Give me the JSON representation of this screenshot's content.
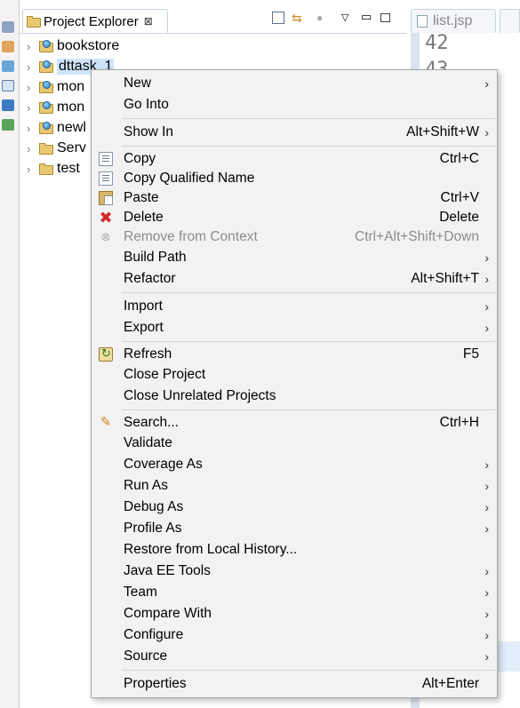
{
  "explorer": {
    "title": "Project Explorer",
    "close_glyph": "⊠",
    "tree": [
      {
        "name": "bookstore",
        "selected": false
      },
      {
        "name": "dttask_1",
        "selected": true
      },
      {
        "name": "mon",
        "selected": false
      },
      {
        "name": "mon",
        "selected": false
      },
      {
        "name": "newl",
        "selected": false
      },
      {
        "name": "Serv",
        "selected": false
      },
      {
        "name": "test",
        "selected": false
      }
    ]
  },
  "editor": {
    "tab_label": "list.jsp",
    "line_numbers": [
      "42",
      "43"
    ]
  },
  "menu": {
    "items": [
      {
        "label": "New",
        "shortcut": "",
        "submenu": true,
        "icon": ""
      },
      {
        "label": "Go Into",
        "shortcut": "",
        "submenu": false,
        "icon": ""
      },
      {
        "label": "Show In",
        "shortcut": "Alt+Shift+W",
        "submenu": true,
        "icon": ""
      },
      {
        "label": "Copy",
        "shortcut": "Ctrl+C",
        "submenu": false,
        "icon": "copy-icon"
      },
      {
        "label": "Copy Qualified Name",
        "shortcut": "",
        "submenu": false,
        "icon": "copy-qualified-name-icon"
      },
      {
        "label": "Paste",
        "shortcut": "Ctrl+V",
        "submenu": false,
        "icon": "paste-icon"
      },
      {
        "label": "Delete",
        "shortcut": "Delete",
        "submenu": false,
        "icon": "delete-icon"
      },
      {
        "label": "Remove from Context",
        "shortcut": "Ctrl+Alt+Shift+Down",
        "submenu": false,
        "icon": "remove-from-context-icon",
        "disabled": true
      },
      {
        "label": "Build Path",
        "shortcut": "",
        "submenu": true,
        "icon": ""
      },
      {
        "label": "Refactor",
        "shortcut": "Alt+Shift+T",
        "submenu": true,
        "icon": ""
      },
      {
        "label": "Import",
        "shortcut": "",
        "submenu": true,
        "icon": ""
      },
      {
        "label": "Export",
        "shortcut": "",
        "submenu": true,
        "icon": ""
      },
      {
        "label": "Refresh",
        "shortcut": "F5",
        "submenu": false,
        "icon": "refresh-icon"
      },
      {
        "label": "Close Project",
        "shortcut": "",
        "submenu": false,
        "icon": ""
      },
      {
        "label": "Close Unrelated Projects",
        "shortcut": "",
        "submenu": false,
        "icon": ""
      },
      {
        "label": "Search...",
        "shortcut": "Ctrl+H",
        "submenu": false,
        "icon": "search-icon"
      },
      {
        "label": "Validate",
        "shortcut": "",
        "submenu": false,
        "icon": ""
      },
      {
        "label": "Coverage As",
        "shortcut": "",
        "submenu": true,
        "icon": ""
      },
      {
        "label": "Run As",
        "shortcut": "",
        "submenu": true,
        "icon": ""
      },
      {
        "label": "Debug As",
        "shortcut": "",
        "submenu": true,
        "icon": ""
      },
      {
        "label": "Profile As",
        "shortcut": "",
        "submenu": true,
        "icon": ""
      },
      {
        "label": "Restore from Local History...",
        "shortcut": "",
        "submenu": false,
        "icon": ""
      },
      {
        "label": "Java EE Tools",
        "shortcut": "",
        "submenu": true,
        "icon": ""
      },
      {
        "label": "Team",
        "shortcut": "",
        "submenu": true,
        "icon": ""
      },
      {
        "label": "Compare With",
        "shortcut": "",
        "submenu": true,
        "icon": ""
      },
      {
        "label": "Configure",
        "shortcut": "",
        "submenu": true,
        "icon": ""
      },
      {
        "label": "Source",
        "shortcut": "",
        "submenu": true,
        "icon": ""
      },
      {
        "label": "Properties",
        "shortcut": "Alt+Enter",
        "submenu": false,
        "icon": ""
      }
    ],
    "submenu_glyph": "›"
  },
  "colors": {
    "menu_bg": "#f2f2f2",
    "selection": "#cfe4fa",
    "delete_red": "#d42a2a"
  }
}
